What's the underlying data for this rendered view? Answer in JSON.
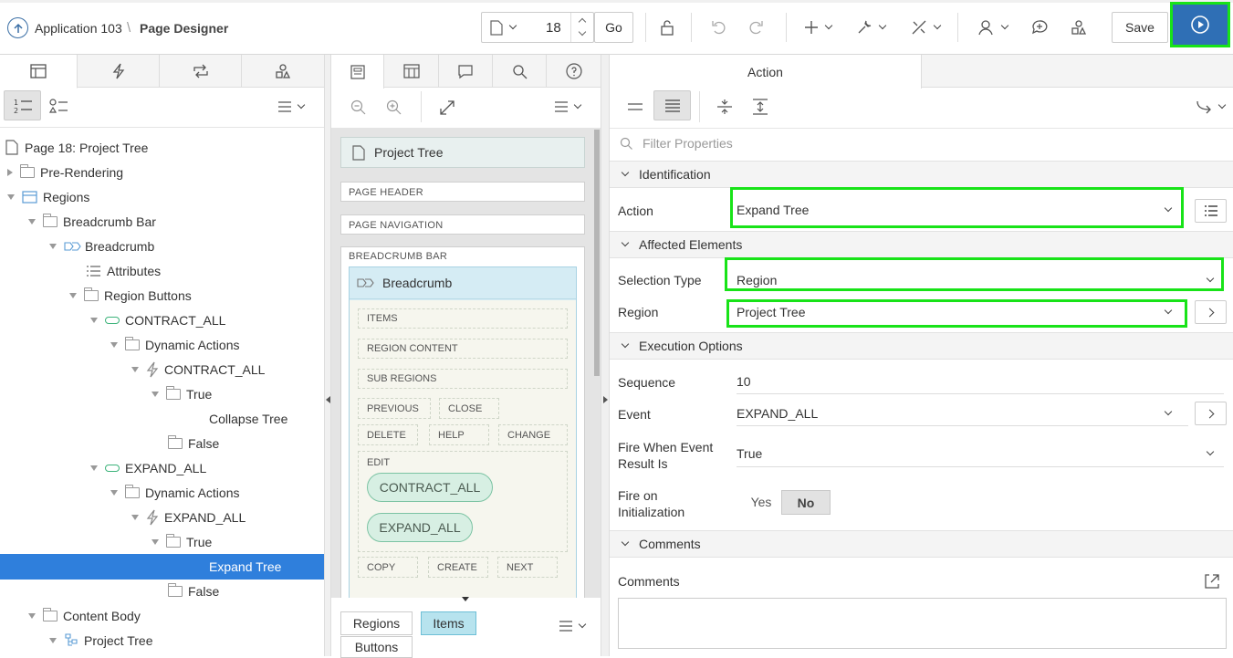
{
  "header": {
    "app_label": "Application 103",
    "separator": "\\",
    "page_designer": "Page Designer",
    "page_number": "18",
    "go_label": "Go",
    "save_label": "Save"
  },
  "left": {
    "tree": [
      {
        "label": "Page 18: Project Tree"
      },
      {
        "label": "Pre-Rendering"
      },
      {
        "label": "Regions"
      },
      {
        "label": "Breadcrumb Bar"
      },
      {
        "label": "Breadcrumb"
      },
      {
        "label": "Attributes"
      },
      {
        "label": "Region Buttons"
      },
      {
        "label": "CONTRACT_ALL"
      },
      {
        "label": "Dynamic Actions"
      },
      {
        "label": "CONTRACT_ALL"
      },
      {
        "label": "True"
      },
      {
        "label": "Collapse Tree"
      },
      {
        "label": "False"
      },
      {
        "label": "EXPAND_ALL"
      },
      {
        "label": "Dynamic Actions"
      },
      {
        "label": "EXPAND_ALL"
      },
      {
        "label": "True"
      },
      {
        "label": "Expand Tree"
      },
      {
        "label": "False"
      },
      {
        "label": "Content Body"
      },
      {
        "label": "Project Tree"
      }
    ]
  },
  "middle": {
    "page_title": "Project Tree",
    "page_header": "PAGE HEADER",
    "page_navigation": "PAGE NAVIGATION",
    "breadcrumb_bar": "BREADCRUMB BAR",
    "breadcrumb_region": "Breadcrumb",
    "items": "ITEMS",
    "region_content": "REGION CONTENT",
    "sub_regions": "SUB REGIONS",
    "previous": "PREVIOUS",
    "close": "CLOSE",
    "delete": "DELETE",
    "help": "HELP",
    "change": "CHANGE",
    "edit": "EDIT",
    "contract_all": "CONTRACT_ALL",
    "expand_all": "EXPAND_ALL",
    "copy": "COPY",
    "create": "CREATE",
    "next": "NEXT",
    "tab_regions": "Regions",
    "tab_items": "Items",
    "tab_buttons": "Buttons"
  },
  "right": {
    "tab_title": "Action",
    "filter_placeholder": "Filter Properties",
    "sections": {
      "identification": "Identification",
      "affected": "Affected Elements",
      "execution": "Execution Options",
      "comments": "Comments"
    },
    "labels": {
      "action": "Action",
      "selection_type": "Selection Type",
      "region": "Region",
      "sequence": "Sequence",
      "event": "Event",
      "fire_when_1": "Fire When Event",
      "fire_when_2": "Result Is",
      "fire_init_1": "Fire on",
      "fire_init_2": "Initialization",
      "comments": "Comments"
    },
    "values": {
      "action": "Expand Tree",
      "selection_type": "Region",
      "region": "Project Tree",
      "sequence": "10",
      "event": "EXPAND_ALL",
      "fire_when": "True",
      "yes": "Yes",
      "no": "No"
    }
  },
  "colors": {
    "selected_row": "#2f7fdc",
    "highlight": "#18e318",
    "run_button": "#2f6fb5"
  }
}
